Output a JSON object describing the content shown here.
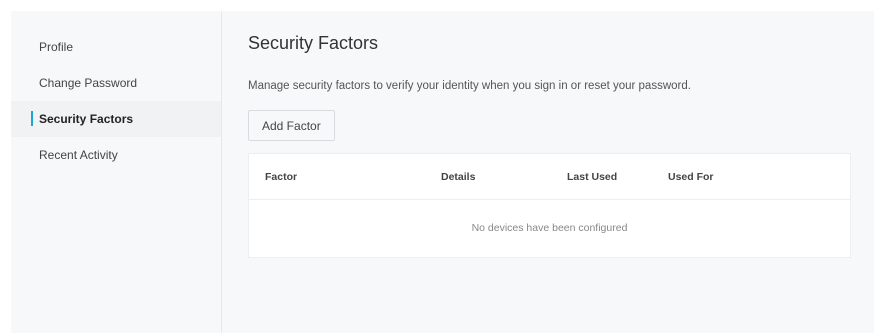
{
  "sidebar": {
    "items": [
      {
        "label": "Profile"
      },
      {
        "label": "Change Password"
      },
      {
        "label": "Security Factors"
      },
      {
        "label": "Recent Activity"
      }
    ]
  },
  "main": {
    "title": "Security Factors",
    "description": "Manage security factors to verify your identity when you sign in or reset your password.",
    "add_button_label": "Add Factor"
  },
  "table": {
    "columns": [
      "Factor",
      "Details",
      "Last Used",
      "Used For"
    ],
    "empty_message": "No devices have been configured"
  },
  "colors": {
    "accent": "#1ba4d6",
    "background": "#f7f8fa"
  }
}
